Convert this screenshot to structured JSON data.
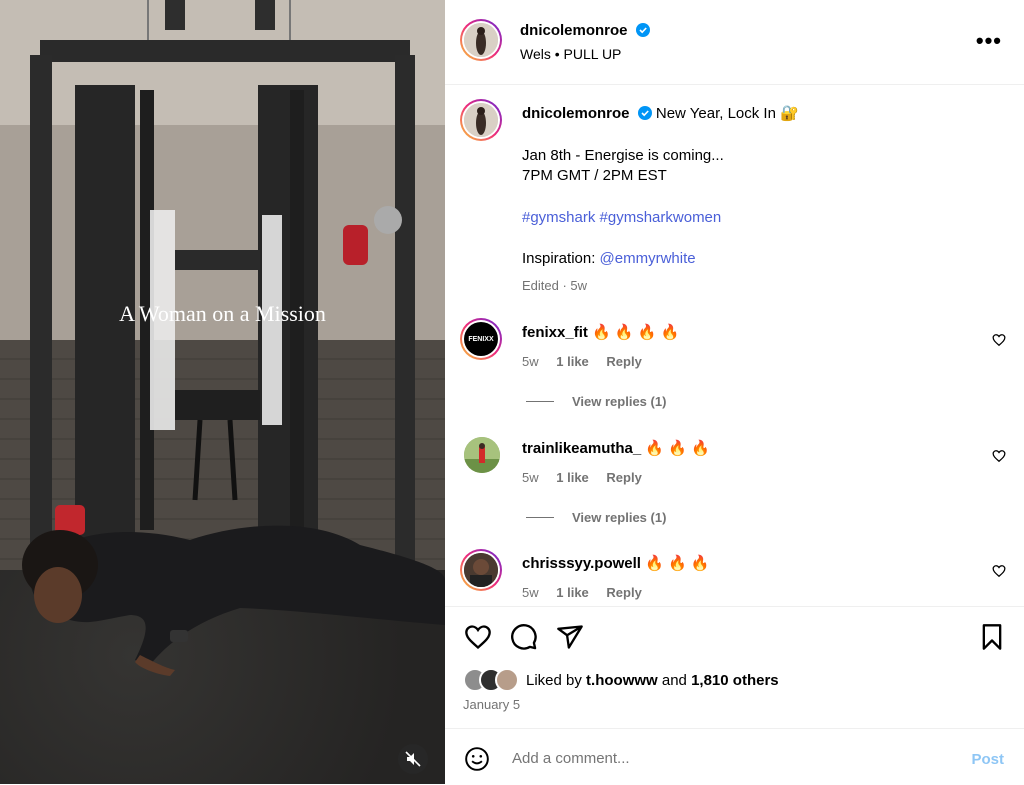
{
  "media": {
    "overlay_text": "A Woman on a Mission"
  },
  "header": {
    "username": "dnicolemonroe",
    "location": "Wels",
    "separator": "•",
    "audio": "PULL UP",
    "more_label": "•••"
  },
  "caption": {
    "username": "dnicolemonroe",
    "title": "New Year, Lock In 🔐",
    "line1": "Jan 8th - Energise is coming...",
    "line2": "7PM GMT / 2PM EST",
    "hashtag1": "#gymshark",
    "hashtag2": "#gymsharkwomen",
    "inspiration_label": "Inspiration:",
    "inspiration_handle": "@emmyrwhite",
    "edited": "Edited · 5w"
  },
  "comments": [
    {
      "username": "fenixx_fit",
      "text": "🔥 🔥 🔥 🔥",
      "age": "5w",
      "likes": "1 like",
      "reply": "Reply",
      "view_replies": "View replies (1)",
      "avatar_label": "FENIXX"
    },
    {
      "username": "trainlikeamutha_",
      "text": "🔥 🔥 🔥",
      "age": "5w",
      "likes": "1 like",
      "reply": "Reply",
      "view_replies": "View replies (1)"
    },
    {
      "username": "chrisssyy.powell",
      "text": "🔥 🔥 🔥",
      "age": "5w",
      "likes": "1 like",
      "reply": "Reply"
    }
  ],
  "likes": {
    "prefix": "Liked by",
    "user": "t.hoowww",
    "and": "and",
    "others": "1,810 others"
  },
  "date": "January 5",
  "comment_box": {
    "placeholder": "Add a comment...",
    "post_label": "Post"
  },
  "colors": {
    "accent": "#0095f6",
    "post_disabled": "#8ec6f5",
    "hashtag": "#4a5fd8"
  },
  "icons": [
    "verified-icon",
    "more-icon",
    "heart-icon",
    "comment-icon",
    "share-icon",
    "bookmark-icon",
    "emoji-icon",
    "mute-icon"
  ]
}
